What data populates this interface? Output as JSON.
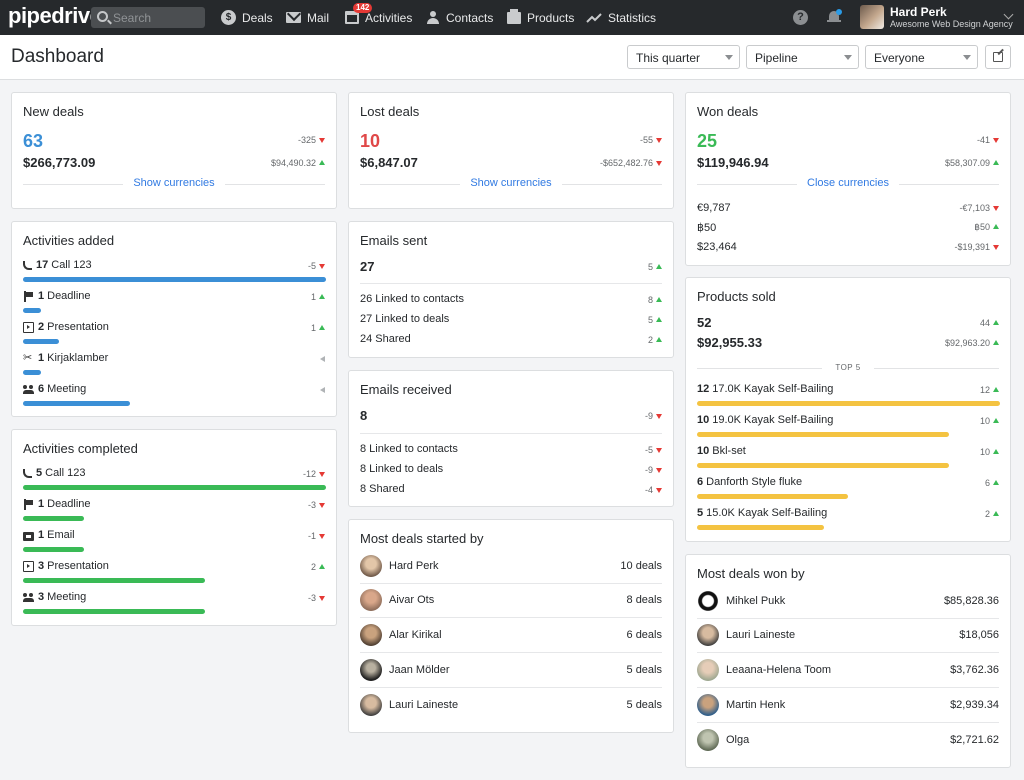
{
  "app": {
    "logo": "pipedrive"
  },
  "search": {
    "placeholder": "Search"
  },
  "nav": [
    {
      "label": "Deals",
      "icon": "dollar-icon"
    },
    {
      "label": "Mail",
      "icon": "mail-icon"
    },
    {
      "label": "Activities",
      "icon": "calendar-icon",
      "badge": "142"
    },
    {
      "label": "Contacts",
      "icon": "person-icon"
    },
    {
      "label": "Products",
      "icon": "box-icon"
    },
    {
      "label": "Statistics",
      "icon": "trend-icon"
    }
  ],
  "user": {
    "name": "Hard Perk",
    "company": "Awesome Web Design Agency"
  },
  "header": {
    "title": "Dashboard",
    "filters": {
      "period": "This quarter",
      "pipeline": "Pipeline",
      "owner": "Everyone"
    }
  },
  "colors": {
    "blue": "#3b8fd6",
    "red": "#e04848",
    "green": "#3aba56",
    "yellow": "#f4c341",
    "link": "#317ae2"
  },
  "new_deals": {
    "title": "New deals",
    "count": "63",
    "count_change": "-325",
    "amount": "$266,773.09",
    "amount_change": "$94,490.32",
    "link": "Show currencies"
  },
  "lost_deals": {
    "title": "Lost deals",
    "count": "10",
    "count_change": "-55",
    "amount": "$6,847.07",
    "amount_change": "-$652,482.76",
    "link": "Show currencies"
  },
  "won_deals": {
    "title": "Won deals",
    "count": "25",
    "count_change": "-41",
    "amount": "$119,946.94",
    "amount_change": "$58,307.09",
    "link": "Close currencies",
    "currencies": [
      {
        "value": "€9,787",
        "change": "-€7,103",
        "trend": "down"
      },
      {
        "value": "฿50",
        "change": "฿50",
        "trend": "up"
      },
      {
        "value": "$23,464",
        "change": "-$19,391",
        "trend": "down"
      }
    ]
  },
  "activities_added": {
    "title": "Activities added",
    "rows": [
      {
        "count": "17",
        "label": "Call 123",
        "change": "-5",
        "trend": "down",
        "fraction": 1.0
      },
      {
        "count": "1",
        "label": "Deadline",
        "change": "1",
        "trend": "up",
        "fraction": 0.06
      },
      {
        "count": "2",
        "label": "Presentation",
        "change": "1",
        "trend": "up",
        "fraction": 0.12
      },
      {
        "count": "1",
        "label": "Kirjaklamber",
        "change": "",
        "trend": "flat",
        "fraction": 0.06
      },
      {
        "count": "6",
        "label": "Meeting",
        "change": "",
        "trend": "flat",
        "fraction": 0.35
      }
    ]
  },
  "activities_completed": {
    "title": "Activities completed",
    "rows": [
      {
        "count": "5",
        "label": "Call 123",
        "change": "-12",
        "trend": "down",
        "fraction": 1.0
      },
      {
        "count": "1",
        "label": "Deadline",
        "change": "-3",
        "trend": "down",
        "fraction": 0.2
      },
      {
        "count": "1",
        "label": "Email",
        "change": "-1",
        "trend": "down",
        "fraction": 0.2
      },
      {
        "count": "3",
        "label": "Presentation",
        "change": "2",
        "trend": "up",
        "fraction": 0.6
      },
      {
        "count": "3",
        "label": "Meeting",
        "change": "-3",
        "trend": "down",
        "fraction": 0.6
      }
    ]
  },
  "emails_sent": {
    "title": "Emails sent",
    "total": "27",
    "total_change": "5",
    "rows": [
      {
        "label": "26 Linked to contacts",
        "change": "8"
      },
      {
        "label": "27 Linked to deals",
        "change": "5"
      },
      {
        "label": "24 Shared",
        "change": "2"
      }
    ]
  },
  "emails_received": {
    "title": "Emails received",
    "total": "8",
    "total_change": "-9",
    "rows": [
      {
        "label": "8 Linked to contacts",
        "change": "-5"
      },
      {
        "label": "8 Linked to deals",
        "change": "-9"
      },
      {
        "label": "8 Shared",
        "change": "-4"
      }
    ]
  },
  "products_sold": {
    "title": "Products sold",
    "count": "52",
    "count_change": "44",
    "amount": "$92,955.33",
    "amount_change": "$92,963.20",
    "top_label": "TOP 5",
    "rows": [
      {
        "count": "12",
        "label": "17.0K Kayak Self-Bailing",
        "change": "12",
        "fraction": 1.0
      },
      {
        "count": "10",
        "label": "19.0K Kayak Self-Bailing",
        "change": "10",
        "fraction": 0.83
      },
      {
        "count": "10",
        "label": "Bkl-set",
        "change": "10",
        "fraction": 0.83
      },
      {
        "count": "6",
        "label": "Danforth Style fluke",
        "change": "6",
        "fraction": 0.5
      },
      {
        "count": "5",
        "label": "15.0K Kayak Self-Bailing",
        "change": "2",
        "fraction": 0.42
      }
    ]
  },
  "most_started": {
    "title": "Most deals started by",
    "rows": [
      {
        "name": "Hard Perk",
        "value": "10 deals"
      },
      {
        "name": "Aivar Ots",
        "value": "8 deals"
      },
      {
        "name": "Alar Kirikal",
        "value": "6 deals"
      },
      {
        "name": "Jaan Mölder",
        "value": "5 deals"
      },
      {
        "name": "Lauri Laineste",
        "value": "5 deals"
      }
    ]
  },
  "most_won": {
    "title": "Most deals won by",
    "rows": [
      {
        "name": "Mihkel Pukk",
        "value": "$85,828.36"
      },
      {
        "name": "Lauri Laineste",
        "value": "$18,056"
      },
      {
        "name": "Leaana-Helena Toom",
        "value": "$3,762.36"
      },
      {
        "name": "Martin Henk",
        "value": "$2,939.34"
      },
      {
        "name": "Olga",
        "value": "$2,721.62"
      }
    ]
  }
}
